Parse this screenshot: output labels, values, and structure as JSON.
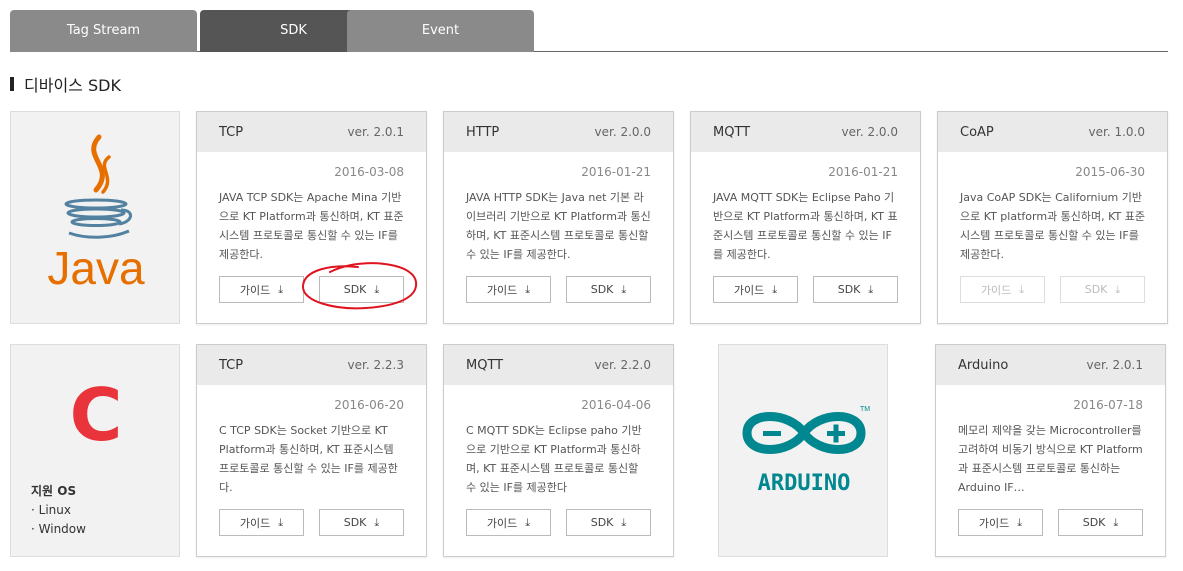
{
  "tabs": [
    {
      "label": "Tag Stream",
      "active": false
    },
    {
      "label": "SDK",
      "active": true
    },
    {
      "label": "Event",
      "active": false
    }
  ],
  "section_title": "디바이스 SDK",
  "java_logo": {
    "text": "Java"
  },
  "c_logo": {
    "letter": "C",
    "os_title": "지원 OS",
    "os_items": [
      "· Linux",
      "· Window"
    ]
  },
  "arduino_logo": {
    "text": "ARDUINO",
    "tm": "TM"
  },
  "cards": [
    {
      "name": "TCP",
      "version": "ver. 2.0.1",
      "date": "2016-03-08",
      "desc": "JAVA TCP SDK는 Apache Mina 기반으로 KT Platform과 통신하며, KT 표준시스템 프로토콜로 통신할 수 있는 IF를 제공한다.",
      "guide": "가이드",
      "sdk": "SDK",
      "disabled": false
    },
    {
      "name": "HTTP",
      "version": "ver. 2.0.0",
      "date": "2016-01-21",
      "desc": "JAVA HTTP SDK는 Java net 기본 라이브러리 기반으로 KT Platform과 통신하며, KT 표준시스템 프로토콜로 통신할 수 있는 IF를 제공한다.",
      "guide": "가이드",
      "sdk": "SDK",
      "disabled": false
    },
    {
      "name": "MQTT",
      "version": "ver. 2.0.0",
      "date": "2016-01-21",
      "desc": "JAVA MQTT SDK는 Eclipse Paho 기반으로 KT Platform과 통신하며, KT 표준시스템 프로토콜로 통신할 수 있는 IF를 제공한다.",
      "guide": "가이드",
      "sdk": "SDK",
      "disabled": false
    },
    {
      "name": "CoAP",
      "version": "ver. 1.0.0",
      "date": "2015-06-30",
      "desc": "Java CoAP SDK는 Californium 기반으로 KT platform과 통신하며, KT 표준시스템 프로토콜로 통신할 수 있는 IF를 제공한다.",
      "guide": "가이드",
      "sdk": "SDK",
      "disabled": true
    },
    {
      "name": "TCP",
      "version": "ver. 2.2.3",
      "date": "2016-06-20",
      "desc": "C TCP SDK는 Socket 기반으로 KT Platform과 통신하며, KT 표준시스템 프로토콜로 통신할 수 있는 IF를 제공한다.",
      "guide": "가이드",
      "sdk": "SDK",
      "disabled": false
    },
    {
      "name": "MQTT",
      "version": "ver. 2.2.0",
      "date": "2016-04-06",
      "desc": "C MQTT SDK는 Eclipse paho 기반으로 기반으로 KT Platform과 통신하며, KT 표준시스템 프로토콜로 통신할 수 있는 IF를 제공한다",
      "guide": "가이드",
      "sdk": "SDK",
      "disabled": false
    },
    {
      "name": "Arduino",
      "version": "ver. 2.0.1",
      "date": "2016-07-18",
      "desc": "메모리 제약을 갖는 Microcontroller를 고려하여 비동기 방식으로 KT Platform과 표준시스템 프로토콜로 통신하는 Arduino IF…",
      "guide": "가이드",
      "sdk": "SDK",
      "disabled": false
    }
  ],
  "colors": {
    "java_orange": "#e76f00",
    "java_blue": "#5382a1",
    "c_red": "#e8343a",
    "arduino_teal": "#00878f",
    "annotation_red": "#e0141e"
  }
}
